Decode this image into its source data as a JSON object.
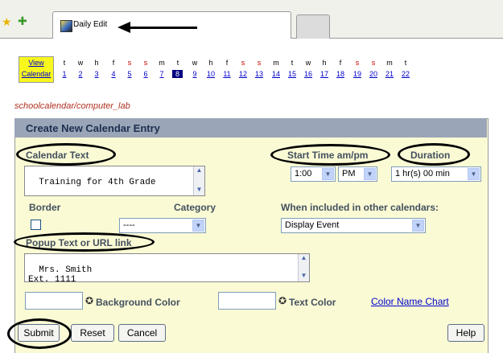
{
  "browser": {
    "tab_label": "Daily Edit"
  },
  "date_strip": {
    "view_calendar_label": "View Calendar",
    "days": [
      {
        "letter": "t",
        "num": "1",
        "weekend": false
      },
      {
        "letter": "w",
        "num": "2",
        "weekend": false
      },
      {
        "letter": "h",
        "num": "3",
        "weekend": false
      },
      {
        "letter": "f",
        "num": "4",
        "weekend": false
      },
      {
        "letter": "s",
        "num": "5",
        "weekend": true
      },
      {
        "letter": "s",
        "num": "6",
        "weekend": true
      },
      {
        "letter": "m",
        "num": "7",
        "weekend": false
      },
      {
        "letter": "t",
        "num": "8",
        "weekend": false,
        "today": true
      },
      {
        "letter": "w",
        "num": "9",
        "weekend": false
      },
      {
        "letter": "h",
        "num": "10",
        "weekend": false
      },
      {
        "letter": "f",
        "num": "11",
        "weekend": false
      },
      {
        "letter": "s",
        "num": "12",
        "weekend": true
      },
      {
        "letter": "s",
        "num": "13",
        "weekend": true
      },
      {
        "letter": "m",
        "num": "14",
        "weekend": false
      },
      {
        "letter": "t",
        "num": "15",
        "weekend": false
      },
      {
        "letter": "w",
        "num": "16",
        "weekend": false
      },
      {
        "letter": "h",
        "num": "17",
        "weekend": false
      },
      {
        "letter": "f",
        "num": "18",
        "weekend": false
      },
      {
        "letter": "s",
        "num": "19",
        "weekend": true
      },
      {
        "letter": "s",
        "num": "20",
        "weekend": true
      },
      {
        "letter": "m",
        "num": "21",
        "weekend": false
      },
      {
        "letter": "t",
        "num": "22",
        "weekend": false
      }
    ]
  },
  "path": "schoolcalendar/computer_lab",
  "form": {
    "title": "Create New Calendar Entry",
    "calendar_text_label": "Calendar Text",
    "calendar_text_value": "Training for 4th Grade",
    "start_time_label": "Start Time am/pm",
    "start_time_value": "1:00",
    "ampm_value": "PM",
    "duration_label": "Duration",
    "duration_value": "1 hr(s) 00 min",
    "border_label": "Border",
    "category_label": "Category",
    "category_value": "----",
    "included_label": "When included in other calendars:",
    "included_value": "Display Event",
    "popup_label": "Popup Text or URL link",
    "popup_value": "Mrs. Smith\nExt. 1111",
    "background_color_label": "Background Color",
    "text_color_label": "Text Color",
    "color_chart_link": "Color Name Chart"
  },
  "buttons": {
    "submit": "Submit",
    "reset": "Reset",
    "cancel": "Cancel",
    "help": "Help"
  }
}
